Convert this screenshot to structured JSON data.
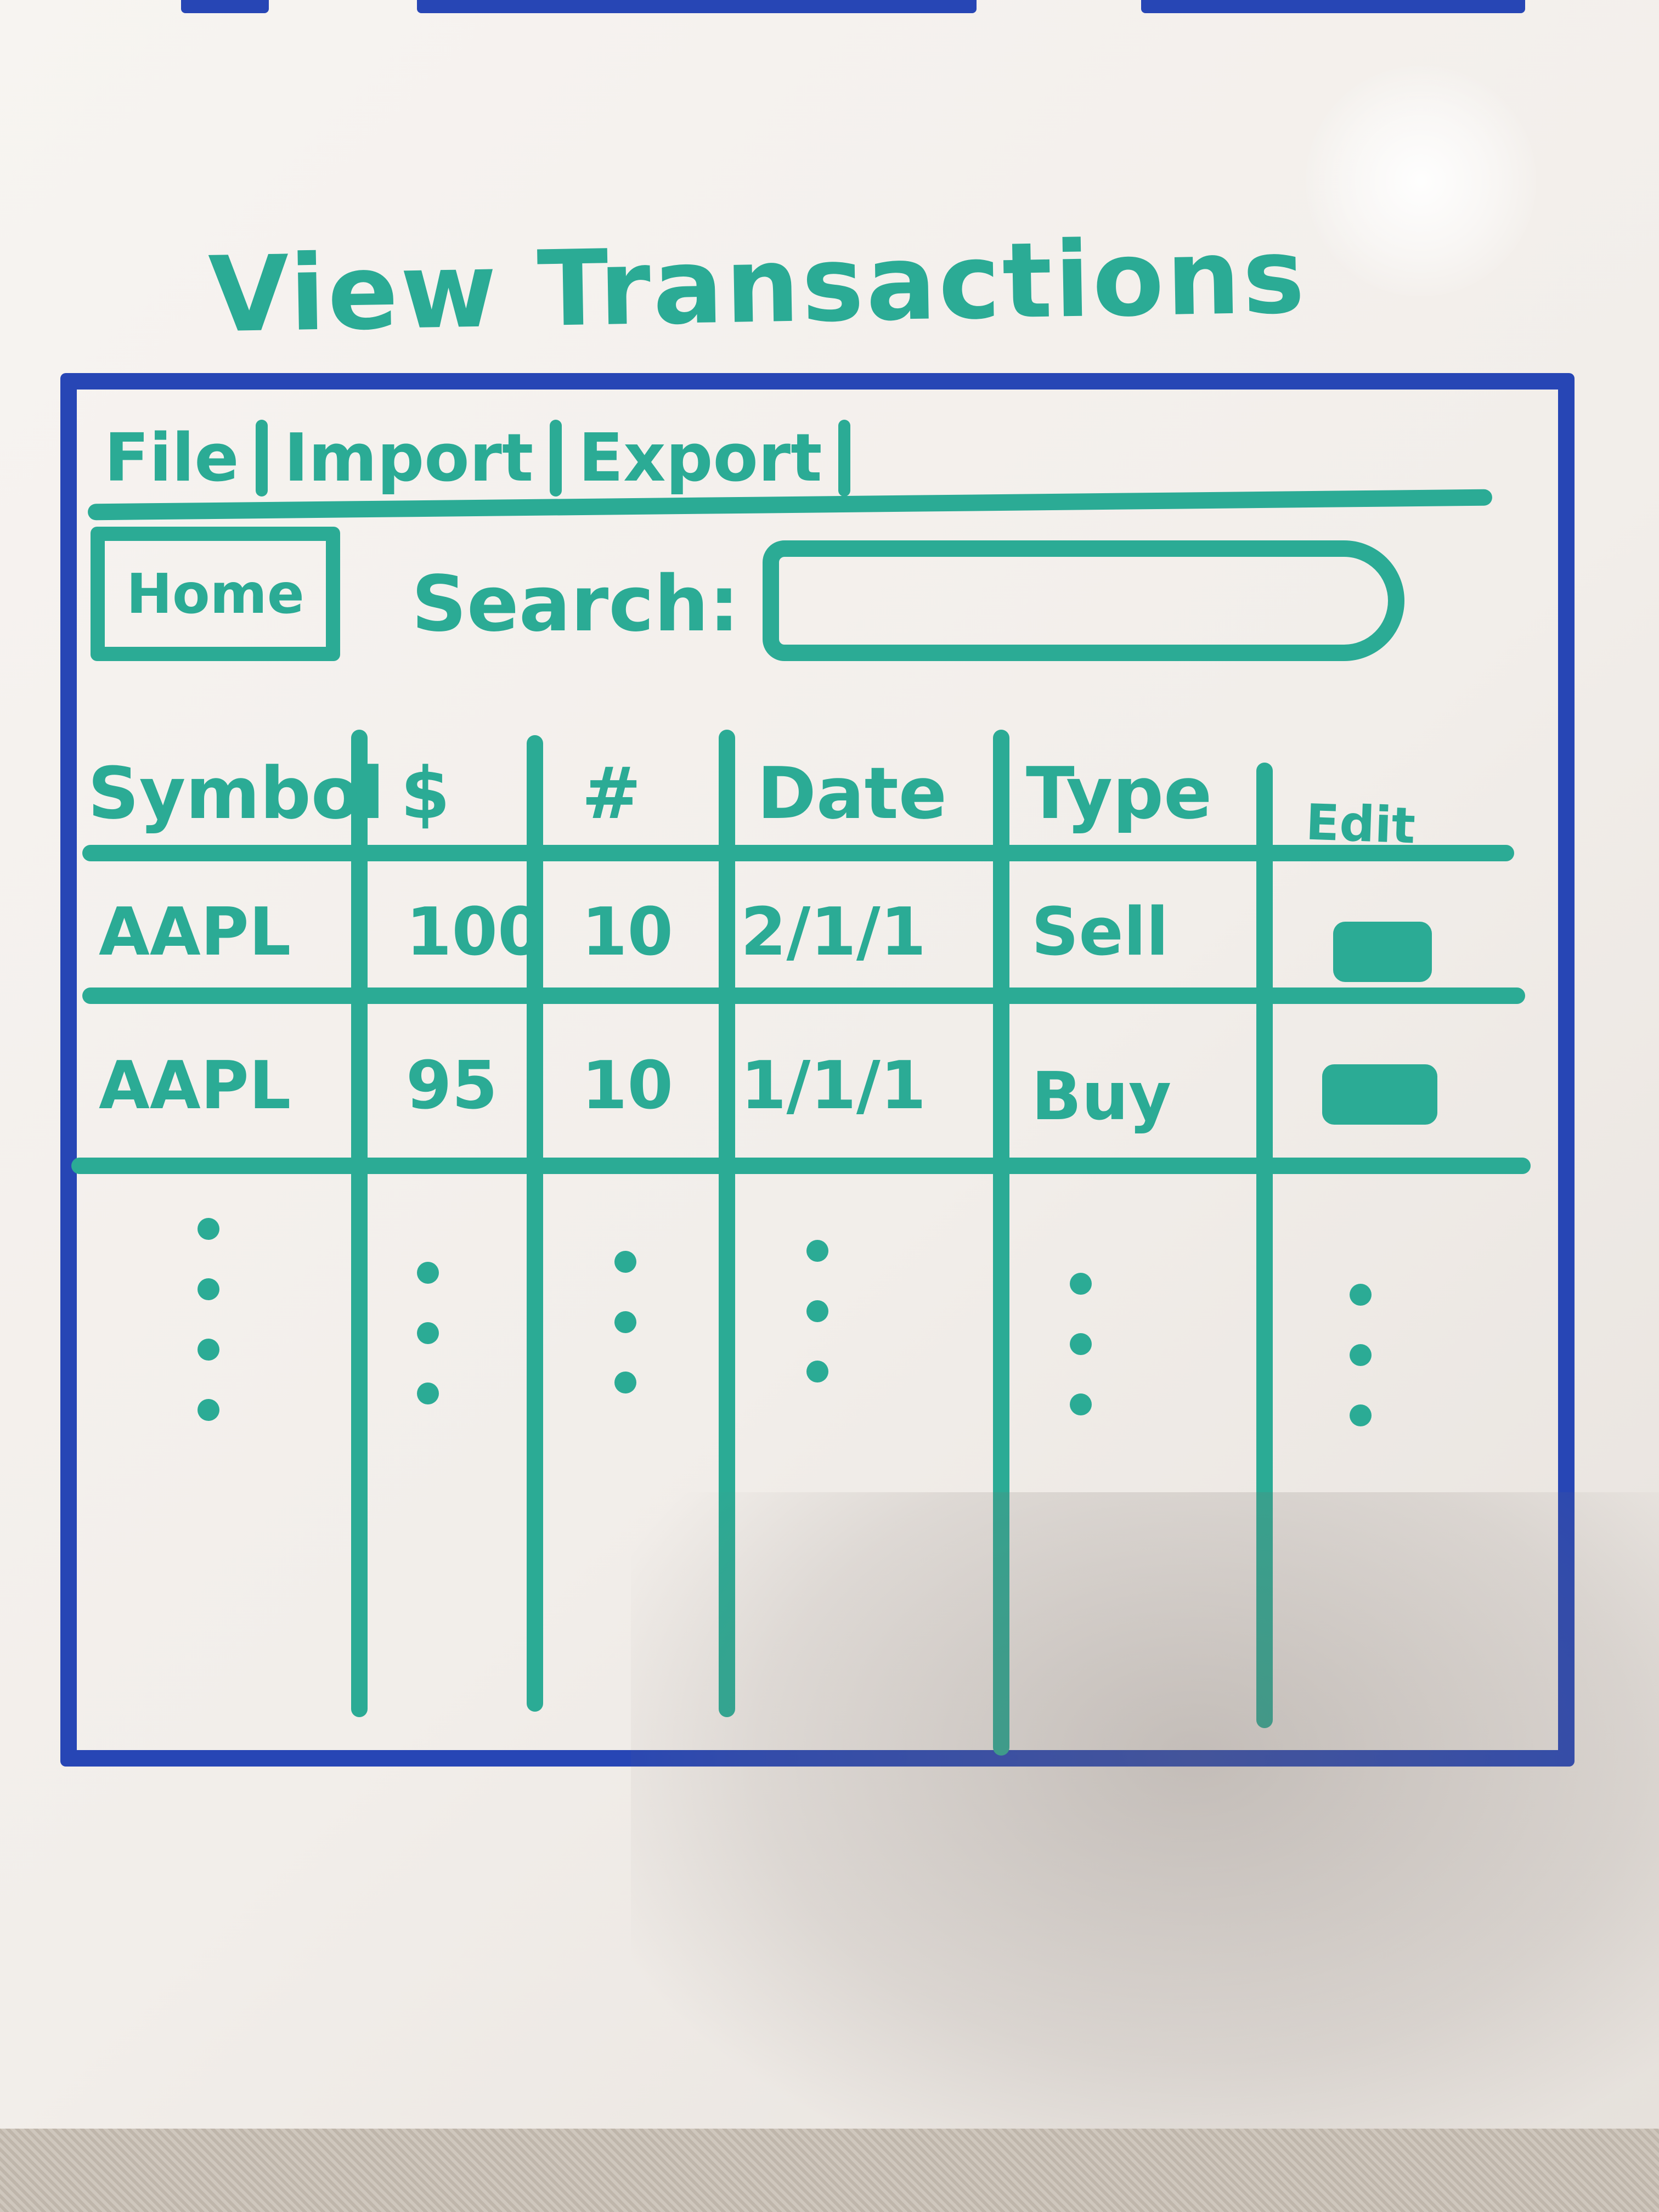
{
  "page": {
    "title": "View Transactions"
  },
  "menu": {
    "items": [
      {
        "label": "File"
      },
      {
        "label": "Import"
      },
      {
        "label": "Export"
      }
    ]
  },
  "toolbar": {
    "home_label": "Home",
    "search_label": "Search:",
    "search_value": ""
  },
  "table": {
    "columns": [
      "Symbol",
      "$",
      "#",
      "Date",
      "Type",
      "Edit"
    ],
    "rows": [
      {
        "symbol": "AAPL",
        "price": "100",
        "quantity": "10",
        "date": "2/1/1",
        "type": "Sell"
      },
      {
        "symbol": "AAPL",
        "price": "95",
        "quantity": "10",
        "date": "1/1/1",
        "type": "Buy"
      }
    ]
  },
  "colors": {
    "marker_teal": "#2bab95",
    "frame_blue": "#2746b5",
    "board_white": "#f4f1ee"
  },
  "icons": {
    "edit": "filled-block-icon",
    "more_rows": "vertical-ellipsis-icon"
  }
}
